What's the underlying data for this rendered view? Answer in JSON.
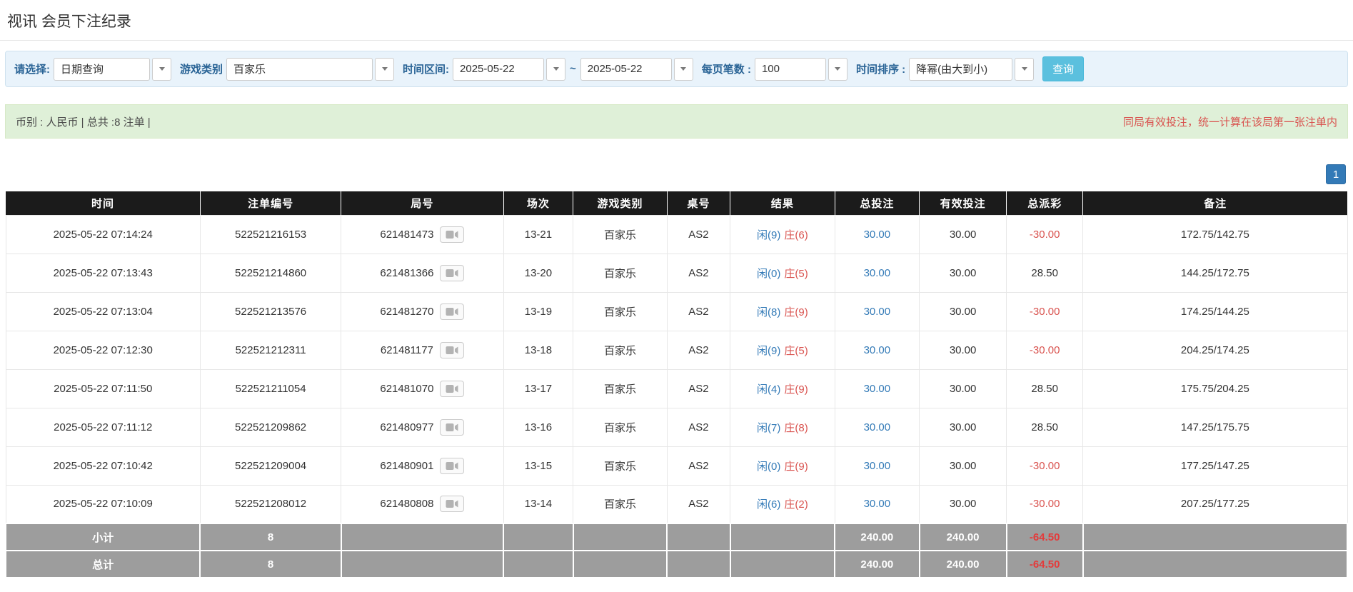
{
  "page": {
    "title": "视讯 会员下注纪录"
  },
  "filters": {
    "select_label": "请选择:",
    "select_value": "日期查询",
    "game_type_label": "游戏类别",
    "game_type_value": "百家乐",
    "time_range_label": "时间区间:",
    "date_from": "2025-05-22",
    "date_separator": "~",
    "date_to": "2025-05-22",
    "page_size_label": "每页笔数 :",
    "page_size_value": "100",
    "sort_label": "时间排序 :",
    "sort_value": "降幂(由大到小)",
    "search_button_label": "查询"
  },
  "summary": {
    "currency_info": "币别 : 人民币 | 总共 :8 注单 |",
    "notice": "同局有效投注，统一计算在该局第一张注单内"
  },
  "pagination": {
    "current_page": "1"
  },
  "table": {
    "headers": [
      "时间",
      "注单编号",
      "局号",
      "场次",
      "游戏类别",
      "桌号",
      "结果",
      "总投注",
      "有效投注",
      "总派彩",
      "备注"
    ],
    "rows": [
      {
        "time": "2025-05-22 07:14:24",
        "bet_id": "522521216153",
        "round_id": "621481473",
        "session": "13-21",
        "game_type": "百家乐",
        "table_no": "AS2",
        "result_player": "闲(9)",
        "result_banker": "庄(6)",
        "total_bet": "30.00",
        "valid_bet": "30.00",
        "payout": "-30.00",
        "remark": "172.75/142.75"
      },
      {
        "time": "2025-05-22 07:13:43",
        "bet_id": "522521214860",
        "round_id": "621481366",
        "session": "13-20",
        "game_type": "百家乐",
        "table_no": "AS2",
        "result_player": "闲(0)",
        "result_banker": "庄(5)",
        "total_bet": "30.00",
        "valid_bet": "30.00",
        "payout": "28.50",
        "remark": "144.25/172.75"
      },
      {
        "time": "2025-05-22 07:13:04",
        "bet_id": "522521213576",
        "round_id": "621481270",
        "session": "13-19",
        "game_type": "百家乐",
        "table_no": "AS2",
        "result_player": "闲(8)",
        "result_banker": "庄(9)",
        "total_bet": "30.00",
        "valid_bet": "30.00",
        "payout": "-30.00",
        "remark": "174.25/144.25"
      },
      {
        "time": "2025-05-22 07:12:30",
        "bet_id": "522521212311",
        "round_id": "621481177",
        "session": "13-18",
        "game_type": "百家乐",
        "table_no": "AS2",
        "result_player": "闲(9)",
        "result_banker": "庄(5)",
        "total_bet": "30.00",
        "valid_bet": "30.00",
        "payout": "-30.00",
        "remark": "204.25/174.25"
      },
      {
        "time": "2025-05-22 07:11:50",
        "bet_id": "522521211054",
        "round_id": "621481070",
        "session": "13-17",
        "game_type": "百家乐",
        "table_no": "AS2",
        "result_player": "闲(4)",
        "result_banker": "庄(9)",
        "total_bet": "30.00",
        "valid_bet": "30.00",
        "payout": "28.50",
        "remark": "175.75/204.25"
      },
      {
        "time": "2025-05-22 07:11:12",
        "bet_id": "522521209862",
        "round_id": "621480977",
        "session": "13-16",
        "game_type": "百家乐",
        "table_no": "AS2",
        "result_player": "闲(7)",
        "result_banker": "庄(8)",
        "total_bet": "30.00",
        "valid_bet": "30.00",
        "payout": "28.50",
        "remark": "147.25/175.75"
      },
      {
        "time": "2025-05-22 07:10:42",
        "bet_id": "522521209004",
        "round_id": "621480901",
        "session": "13-15",
        "game_type": "百家乐",
        "table_no": "AS2",
        "result_player": "闲(0)",
        "result_banker": "庄(9)",
        "total_bet": "30.00",
        "valid_bet": "30.00",
        "payout": "-30.00",
        "remark": "177.25/147.25"
      },
      {
        "time": "2025-05-22 07:10:09",
        "bet_id": "522521208012",
        "round_id": "621480808",
        "session": "13-14",
        "game_type": "百家乐",
        "table_no": "AS2",
        "result_player": "闲(6)",
        "result_banker": "庄(2)",
        "total_bet": "30.00",
        "valid_bet": "30.00",
        "payout": "-30.00",
        "remark": "207.25/177.25"
      }
    ],
    "subtotal": {
      "label": "小计",
      "count": "8",
      "total_bet": "240.00",
      "valid_bet": "240.00",
      "payout": "-64.50"
    },
    "grand_total": {
      "label": "总计",
      "count": "8",
      "total_bet": "240.00",
      "valid_bet": "240.00",
      "payout": "-64.50"
    }
  },
  "colors": {
    "header_bg": "#1b1b1b",
    "footer_bg": "#9d9d9d",
    "player_blue": "#337ab7",
    "banker_red": "#d9534f",
    "negative_red": "#d9534f",
    "link_blue": "#337ab7",
    "search_button_bg": "#5bc0de",
    "pagination_bg": "#337ab7",
    "filter_bar_bg": "#e9f3fb",
    "summary_bar_bg": "#dff0d8"
  }
}
